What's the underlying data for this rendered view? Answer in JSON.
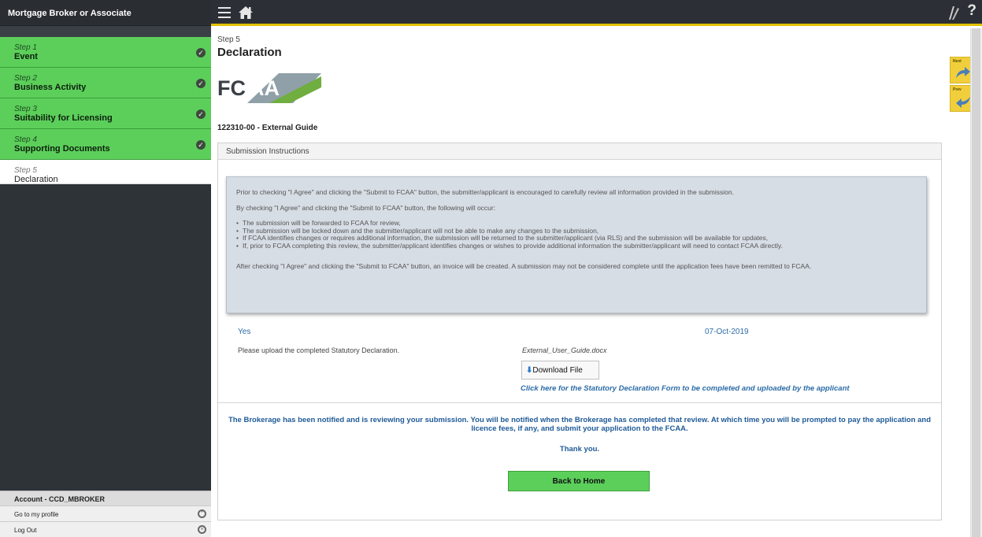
{
  "sidebar": {
    "header": "Mortgage Broker or Associate",
    "steps": [
      {
        "num": "Step 1",
        "title": "Event",
        "done": true
      },
      {
        "num": "Step 2",
        "title": "Business Activity",
        "done": true
      },
      {
        "num": "Step 3",
        "title": "Suitability for Licensing",
        "done": true
      },
      {
        "num": "Step 4",
        "title": "Supporting Documents",
        "done": true
      },
      {
        "num": "Step 5",
        "title": "Declaration",
        "done": false
      }
    ],
    "account": "Account - CCD_MBROKER",
    "profile_link": "Go to my profile",
    "logout_link": "Log Out"
  },
  "topbar": {
    "help": "?"
  },
  "main": {
    "step_label": "Step 5",
    "title": "Declaration",
    "logo_text_dark": "FC",
    "logo_text_light": "AA",
    "guide": "122310-00 - External Guide",
    "panel_title": "Submission Instructions",
    "instructions": {
      "p1": "Prior to checking \"I Agree\" and clicking the \"Submit to FCAA\" button, the submitter/applicant is encouraged to carefully review all information provided in the submission.",
      "p2": "By checking \"I Agree\" and clicking the \"Submit to FCAA\" button, the following will occur:",
      "bullets": [
        "The submission will be forwarded to FCAA for review,",
        "The submission will be locked down and the submitter/applicant will not be able to make any changes to the submission,",
        "If FCAA identifies changes or requires additional information, the submission will be returned to the submitter/applicant (via RLS) and the submission will be available for updates,",
        "If, prior to FCAA completing this review, the submitter/applicant identifies changes or wishes to provide additional information the submitter/applicant will need to contact FCAA directly."
      ],
      "p3": "After checking \"I Agree\" and clicking the \"Submit to FCAA\" button, an invoice will be created. A submission may not be considered complete until the application fees have been remitted to FCAA."
    },
    "agree_value": "Yes",
    "agree_date": "07-Oct-2019",
    "upload_label": "Please upload the completed Statutory Declaration.",
    "file_name": "External_User_Guide.docx",
    "download_label": "Download File",
    "declaration_link": "Click here for the Statutory Declaration Form to be completed and uploaded by the applicant",
    "notice": "The Brokerage has been notified and is reviewing your submission. You will be notified when the Brokerage has completed that review. At which time you will be prompted to pay the application and licence fees, if any, and submit your application to the FCAA.",
    "thanks": "Thank you.",
    "back_button": "Back to Home"
  },
  "side_nav": {
    "next": "Next",
    "prev": "Prev"
  },
  "colors": {
    "step_done": "#5ccf5b",
    "sidebar_bg": "#2e3338",
    "accent_yellow": "#f1cf3c",
    "link_blue": "#2b6ca7"
  }
}
